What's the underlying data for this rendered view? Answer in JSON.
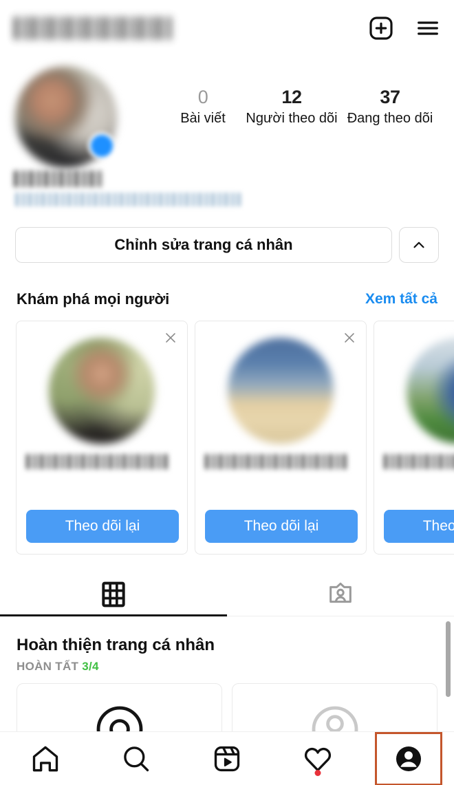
{
  "app": {
    "name": "Instagram",
    "screen": "profile",
    "username_redacted": true
  },
  "topbar": {
    "username": "",
    "add_icon": "plus-square-icon",
    "menu_icon": "hamburger-menu-icon"
  },
  "profile": {
    "avatar_icon": "profile-avatar",
    "avatar_badge_icon": "add-story-badge-icon",
    "full_name": "",
    "bio": "",
    "stats": [
      {
        "value": "0",
        "label": "Bài viết",
        "muted": true
      },
      {
        "value": "12",
        "label": "Người theo dõi",
        "muted": false
      },
      {
        "value": "37",
        "label": "Đang theo dõi",
        "muted": false
      }
    ]
  },
  "actions": {
    "edit_profile_label": "Chỉnh sửa trang cá nhân",
    "chevron_icon": "chevron-up-icon"
  },
  "discover": {
    "title": "Khám phá mọi người",
    "see_all_label": "Xem tất cả",
    "cards": [
      {
        "name": "",
        "button_label": "Theo dõi lại",
        "close_icon": "close-icon",
        "avatar": "user-avatar-1"
      },
      {
        "name": "",
        "button_label": "Theo dõi lại",
        "close_icon": "close-icon",
        "avatar": "user-avatar-2"
      },
      {
        "name": "",
        "button_label": "Theo dõi lại",
        "close_icon": "close-icon",
        "avatar": "user-avatar-3"
      }
    ]
  },
  "tabs": [
    {
      "icon": "grid-icon",
      "active": true
    },
    {
      "icon": "tagged-icon",
      "active": false
    }
  ],
  "complete_profile": {
    "title": "Hoàn thiện trang cá nhân",
    "status_label": "HOÀN TẤT",
    "progress": "3/4",
    "progress_color": "#3fbf42",
    "steps": [
      {
        "icon": "add-photo-circle-icon",
        "state": "active"
      },
      {
        "icon": "add-person-circle-icon",
        "state": "inactive"
      }
    ]
  },
  "bottom_nav": [
    {
      "icon": "home-icon",
      "selected": false,
      "badge": false
    },
    {
      "icon": "search-icon",
      "selected": false,
      "badge": false
    },
    {
      "icon": "reels-icon",
      "selected": false,
      "badge": false
    },
    {
      "icon": "heart-icon",
      "selected": false,
      "badge": true
    },
    {
      "icon": "profile-icon",
      "selected": true,
      "badge": false
    }
  ],
  "colors": {
    "accent_blue": "#4a9cf5",
    "link_blue": "#1a8cf0",
    "selection_orange": "#c4562c",
    "success_green": "#3fbf42",
    "badge_red": "#e8313a"
  }
}
